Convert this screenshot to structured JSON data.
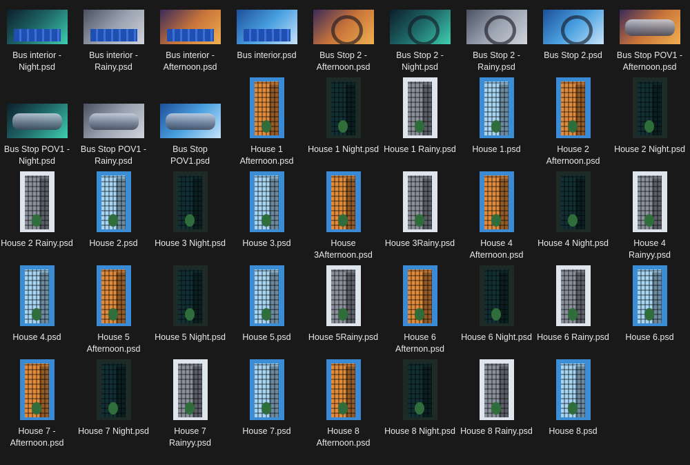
{
  "files": [
    {
      "name": "Bus interior - Night.psd",
      "kind": "bus",
      "theme": "night"
    },
    {
      "name": "Bus interior - Rainy.psd",
      "kind": "bus",
      "theme": "rainy"
    },
    {
      "name": "Bus interior -Afternoon.psd",
      "kind": "bus",
      "theme": "afternoon"
    },
    {
      "name": "Bus interior.psd",
      "kind": "bus",
      "theme": "day"
    },
    {
      "name": "Bus Stop 2 - Afternoon.psd",
      "kind": "stop",
      "theme": "afternoon"
    },
    {
      "name": "Bus Stop 2 - Night.psd",
      "kind": "stop",
      "theme": "night"
    },
    {
      "name": "Bus Stop 2 - Rainy.psd",
      "kind": "stop",
      "theme": "rainy"
    },
    {
      "name": "Bus Stop 2.psd",
      "kind": "stop",
      "theme": "day"
    },
    {
      "name": "Bus Stop POV1 - Afternoon.psd",
      "kind": "pov",
      "theme": "afternoon"
    },
    {
      "name": "Bus Stop POV1 - Night.psd",
      "kind": "pov",
      "theme": "night"
    },
    {
      "name": "Bus Stop POV1 - Rainy.psd",
      "kind": "pov",
      "theme": "rainy"
    },
    {
      "name": "Bus Stop POV1.psd",
      "kind": "pov",
      "theme": "day"
    },
    {
      "name": "House 1 Afternoon.psd",
      "kind": "building",
      "theme": "afternoon"
    },
    {
      "name": "House 1 Night.psd",
      "kind": "building",
      "theme": "night"
    },
    {
      "name": "House 1 Rainy.psd",
      "kind": "building",
      "theme": "rainy"
    },
    {
      "name": "House 1.psd",
      "kind": "building",
      "theme": "day"
    },
    {
      "name": "House 2 Afternoon.psd",
      "kind": "building",
      "theme": "afternoon"
    },
    {
      "name": "House 2 Night.psd",
      "kind": "building",
      "theme": "night"
    },
    {
      "name": "House 2 Rainy.psd",
      "kind": "building",
      "theme": "rainy"
    },
    {
      "name": "House 2.psd",
      "kind": "building",
      "theme": "day"
    },
    {
      "name": "House 3 Night.psd",
      "kind": "building",
      "theme": "night"
    },
    {
      "name": "House 3.psd",
      "kind": "building",
      "theme": "day"
    },
    {
      "name": "House 3Afternoon.psd",
      "kind": "building",
      "theme": "afternoon"
    },
    {
      "name": "House 3Rainy.psd",
      "kind": "building",
      "theme": "rainy"
    },
    {
      "name": "House 4 Afternoon.psd",
      "kind": "building",
      "theme": "afternoon"
    },
    {
      "name": "House 4 Night.psd",
      "kind": "building",
      "theme": "night"
    },
    {
      "name": "House 4 Rainyy.psd",
      "kind": "building",
      "theme": "rainy"
    },
    {
      "name": "House 4.psd",
      "kind": "building",
      "theme": "day"
    },
    {
      "name": "House 5 Afternoon.psd",
      "kind": "building",
      "theme": "afternoon"
    },
    {
      "name": "House 5 Night.psd",
      "kind": "building",
      "theme": "night"
    },
    {
      "name": "House 5.psd",
      "kind": "building",
      "theme": "day"
    },
    {
      "name": "House 5Rainy.psd",
      "kind": "building",
      "theme": "rainy"
    },
    {
      "name": "House 6 Afternon.psd",
      "kind": "building",
      "theme": "afternoon"
    },
    {
      "name": "House 6 Night.psd",
      "kind": "building",
      "theme": "night"
    },
    {
      "name": "House 6 Rainy.psd",
      "kind": "building",
      "theme": "rainy"
    },
    {
      "name": "House 6.psd",
      "kind": "building",
      "theme": "day"
    },
    {
      "name": "House 7 - Afternoon.psd",
      "kind": "building",
      "theme": "afternoon"
    },
    {
      "name": "House 7 Night.psd",
      "kind": "building",
      "theme": "night"
    },
    {
      "name": "House 7 Rainyy.psd",
      "kind": "building",
      "theme": "rainy"
    },
    {
      "name": "House 7.psd",
      "kind": "building",
      "theme": "day"
    },
    {
      "name": "House 8 Afternoon.psd",
      "kind": "building",
      "theme": "afternoon"
    },
    {
      "name": "House 8 Night.psd",
      "kind": "building",
      "theme": "night"
    },
    {
      "name": "House 8 Rainy.psd",
      "kind": "building",
      "theme": "rainy"
    },
    {
      "name": "House 8.psd",
      "kind": "building",
      "theme": "day"
    }
  ],
  "themes": {
    "afternoon": {
      "bg": "#3a8ad6",
      "fg": "#e08a3c",
      "wide": "linear-gradient(135deg,#3a2a5a,#c8743a 50%,#f0b050)"
    },
    "night": {
      "bg": "#1e2a26",
      "fg": "#123034",
      "wide": "linear-gradient(135deg,#0d1e2a,#1f6a6a 50%,#3fd0b0)"
    },
    "rainy": {
      "bg": "#dfe5ec",
      "fg": "#8a909b",
      "wide": "linear-gradient(135deg,#4a5060,#9aa2b0 50%,#d0d4dc)"
    },
    "day": {
      "bg": "#3b8ed6",
      "fg": "#a6d4f2",
      "wide": "linear-gradient(135deg,#1c4f9a,#4aa0e0 50%,#c8e4f8)"
    }
  }
}
